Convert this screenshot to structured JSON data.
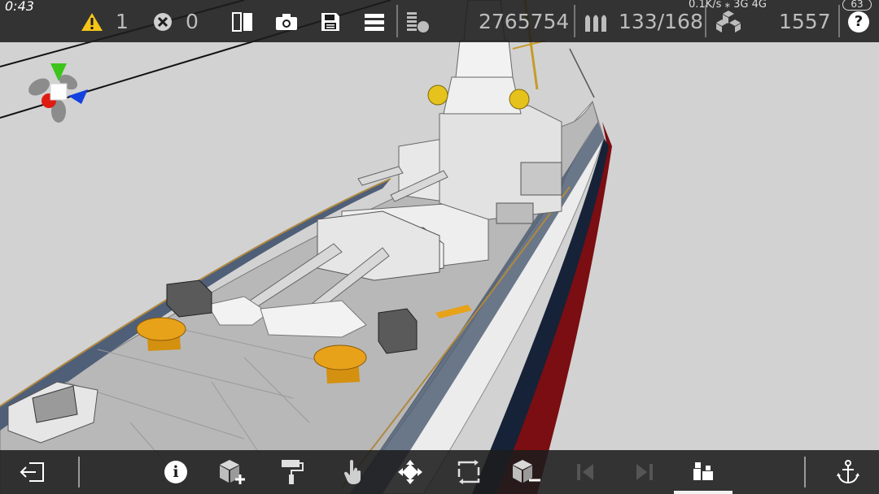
{
  "status_bar": {
    "time": "0:43",
    "network": "0.1K/s ⁎ 3G 4G",
    "battery": "63"
  },
  "toolbar": {
    "warnings_count": "1",
    "errors_count": "0",
    "triangle_count": "2765754",
    "parts_count": "133/168",
    "cubes_count": "1557",
    "help_label": "?"
  },
  "bottom_toolbar": {
    "info_label": "i"
  },
  "colors": {
    "toolbar_bg": "#1c1c1c",
    "warning_yellow": "#f5c518",
    "viewport_bg": "#d2d2d2",
    "gizmo_green": "#3dc41c",
    "gizmo_red": "#e01b12",
    "gizmo_blue": "#1440e0",
    "hull_red": "#7a0e12",
    "hull_navy": "#162238",
    "turret_gold": "#e8a21a"
  }
}
